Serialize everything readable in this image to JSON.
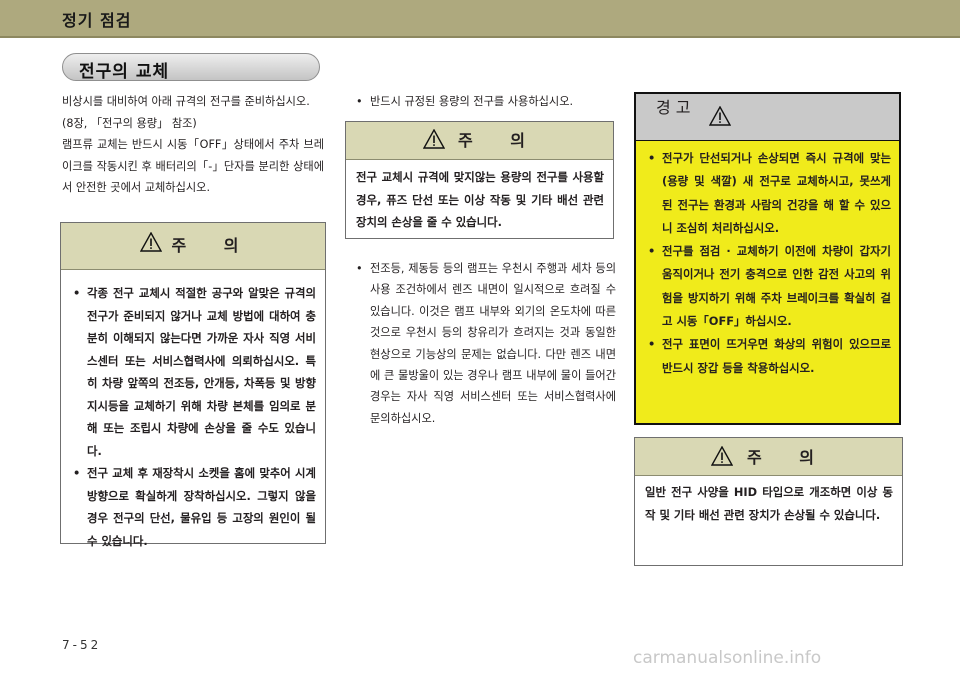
{
  "header": {
    "section_title": "정기 점검"
  },
  "page_title": "전구의 교체",
  "left_column": {
    "intro_lines": [
      "비상시를 대비하여 아래 규격의 전구를 준비하십시오.",
      "(8장, 「전구의 용량」 참조)",
      "램프류 교체는 반드시 시동「OFF」상태에서 주차 브레이크를 작동시킨 후 배터리의「-」단자를 분리한 상태에서 안전한 곳에서 교체하십시오."
    ],
    "caution": {
      "title": "주 의",
      "items": [
        "각종 전구 교체시 적절한 공구와 알맞은 규격의 전구가 준비되지 않거나 교체 방법에 대하여 충분히 이해되지 않는다면 가까운 자사 직영 서비스센터 또는 서비스협력사에 의뢰하십시오. 특히 차량 앞쪽의 전조등, 안개등, 차폭등 및 방향 지시등을 교체하기 위해 차량 본체를 임의로 분해 또는 조립시 차량에 손상을 줄 수도 있습니다.",
        "전구 교체 후 재장착시 소켓을 홈에 맞추어 시계방향으로 확실하게 장착하십시오. 그렇지 않을 경우 전구의 단선, 물유입 등 고장의 원인이 될 수 있습니다."
      ]
    }
  },
  "middle_column": {
    "top_bullet": "반드시 규정된 용량의 전구를 사용하십시오.",
    "caution": {
      "title": "주 의",
      "text": "전구 교체시 규격에 맞지않는 용량의 전구를 사용할 경우, 퓨즈 단선 또는 이상 작동 및 기타 배선 관련 장치의 손상을 줄 수 있습니다."
    },
    "bottom_bullet": "전조등, 제동등 등의 램프는 우천시 주행과 세차 등의 사용 조건하에서 렌즈 내면이 일시적으로 흐려질 수 있습니다. 이것은 램프 내부와 외기의 온도차에 따른것으로 우천시 등의 창유리가 흐려지는 것과 동일한 현상으로 기능상의 문제는 없습니다. 다만 렌즈 내면에 큰 물방울이 있는 경우나 램프 내부에 물이 들어간 경우는 자사 직영 서비스센터 또는 서비스협력사에 문의하십시오."
  },
  "right_column": {
    "warning": {
      "title": "경 고",
      "items": [
        "전구가 단선되거나 손상되면 즉시 규격에 맞는(용량 및 색깔) 새 전구로 교체하시고, 못쓰게 된 전구는 환경과 사람의 건강을 해 할 수 있으니 조심히 처리하십시오.",
        "전구를 점검 · 교체하기 이전에 차량이 갑자기 움직이거나 전기 충격으로 인한 감전 사고의 위험을 방지하기 위해 주차 브레이크를 확실히 걸고 시동「OFF」하십시오.",
        "전구 표면이 뜨거우면 화상의 위험이 있으므로 반드시 장갑 등을 착용하십시오."
      ]
    },
    "caution": {
      "title": "주 의",
      "text": "일반 전구 사양을 HID 타입으로 개조하면 이상 동작 및 기타 배선 관련 장치가 손상될 수 있습니다."
    }
  },
  "footer": {
    "page_number": "7-52"
  },
  "watermark": "carmanualsonline.info",
  "colors": {
    "header_bg": "#aea97e",
    "caution_head_bg": "#d9d8b4",
    "warning_bg": "#f0eb1b",
    "warning_head_bg": "#c9c9c9"
  }
}
